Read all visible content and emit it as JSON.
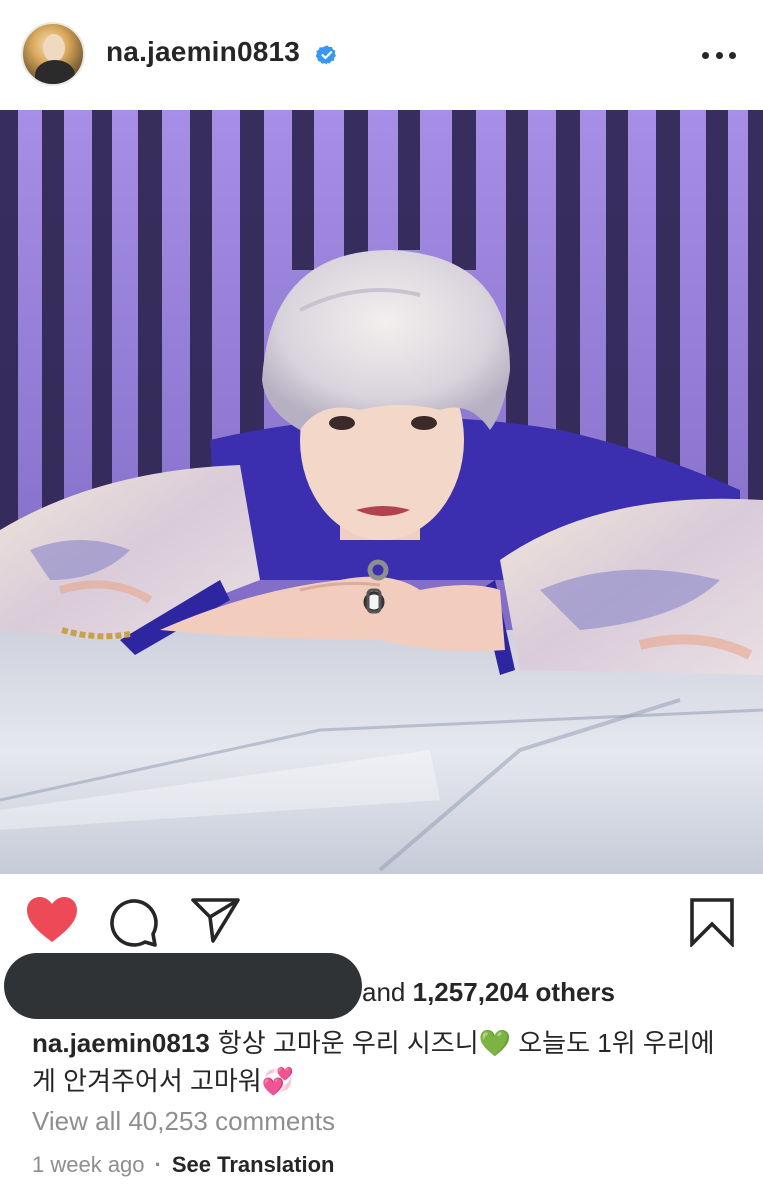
{
  "post": {
    "username": "na.jaemin0813",
    "verified": true,
    "likes": {
      "prefix": "and",
      "count": "1,257,204",
      "suffix": "others"
    },
    "caption": {
      "username": "na.jaemin0813",
      "text": "항상 고마운 우리 시즈니💚 오늘도 1위 우리에게 안겨주어서 고마워💞"
    },
    "view_all_comments": "View all 40,253 comments",
    "timestamp": "1 week ago",
    "separator": "·",
    "see_translation": "See Translation"
  },
  "icons": {
    "avatar": "profile-avatar",
    "verified": "verified-badge-icon",
    "more": "more-options-icon",
    "like": "heart-icon",
    "comment": "comment-icon",
    "share": "share-icon",
    "save": "bookmark-icon"
  },
  "colors": {
    "text": "#262626",
    "secondary": "#8e8e8e",
    "like_red": "#ed4956",
    "verified_blue": "#3897f0",
    "redaction": "#2f3336"
  }
}
